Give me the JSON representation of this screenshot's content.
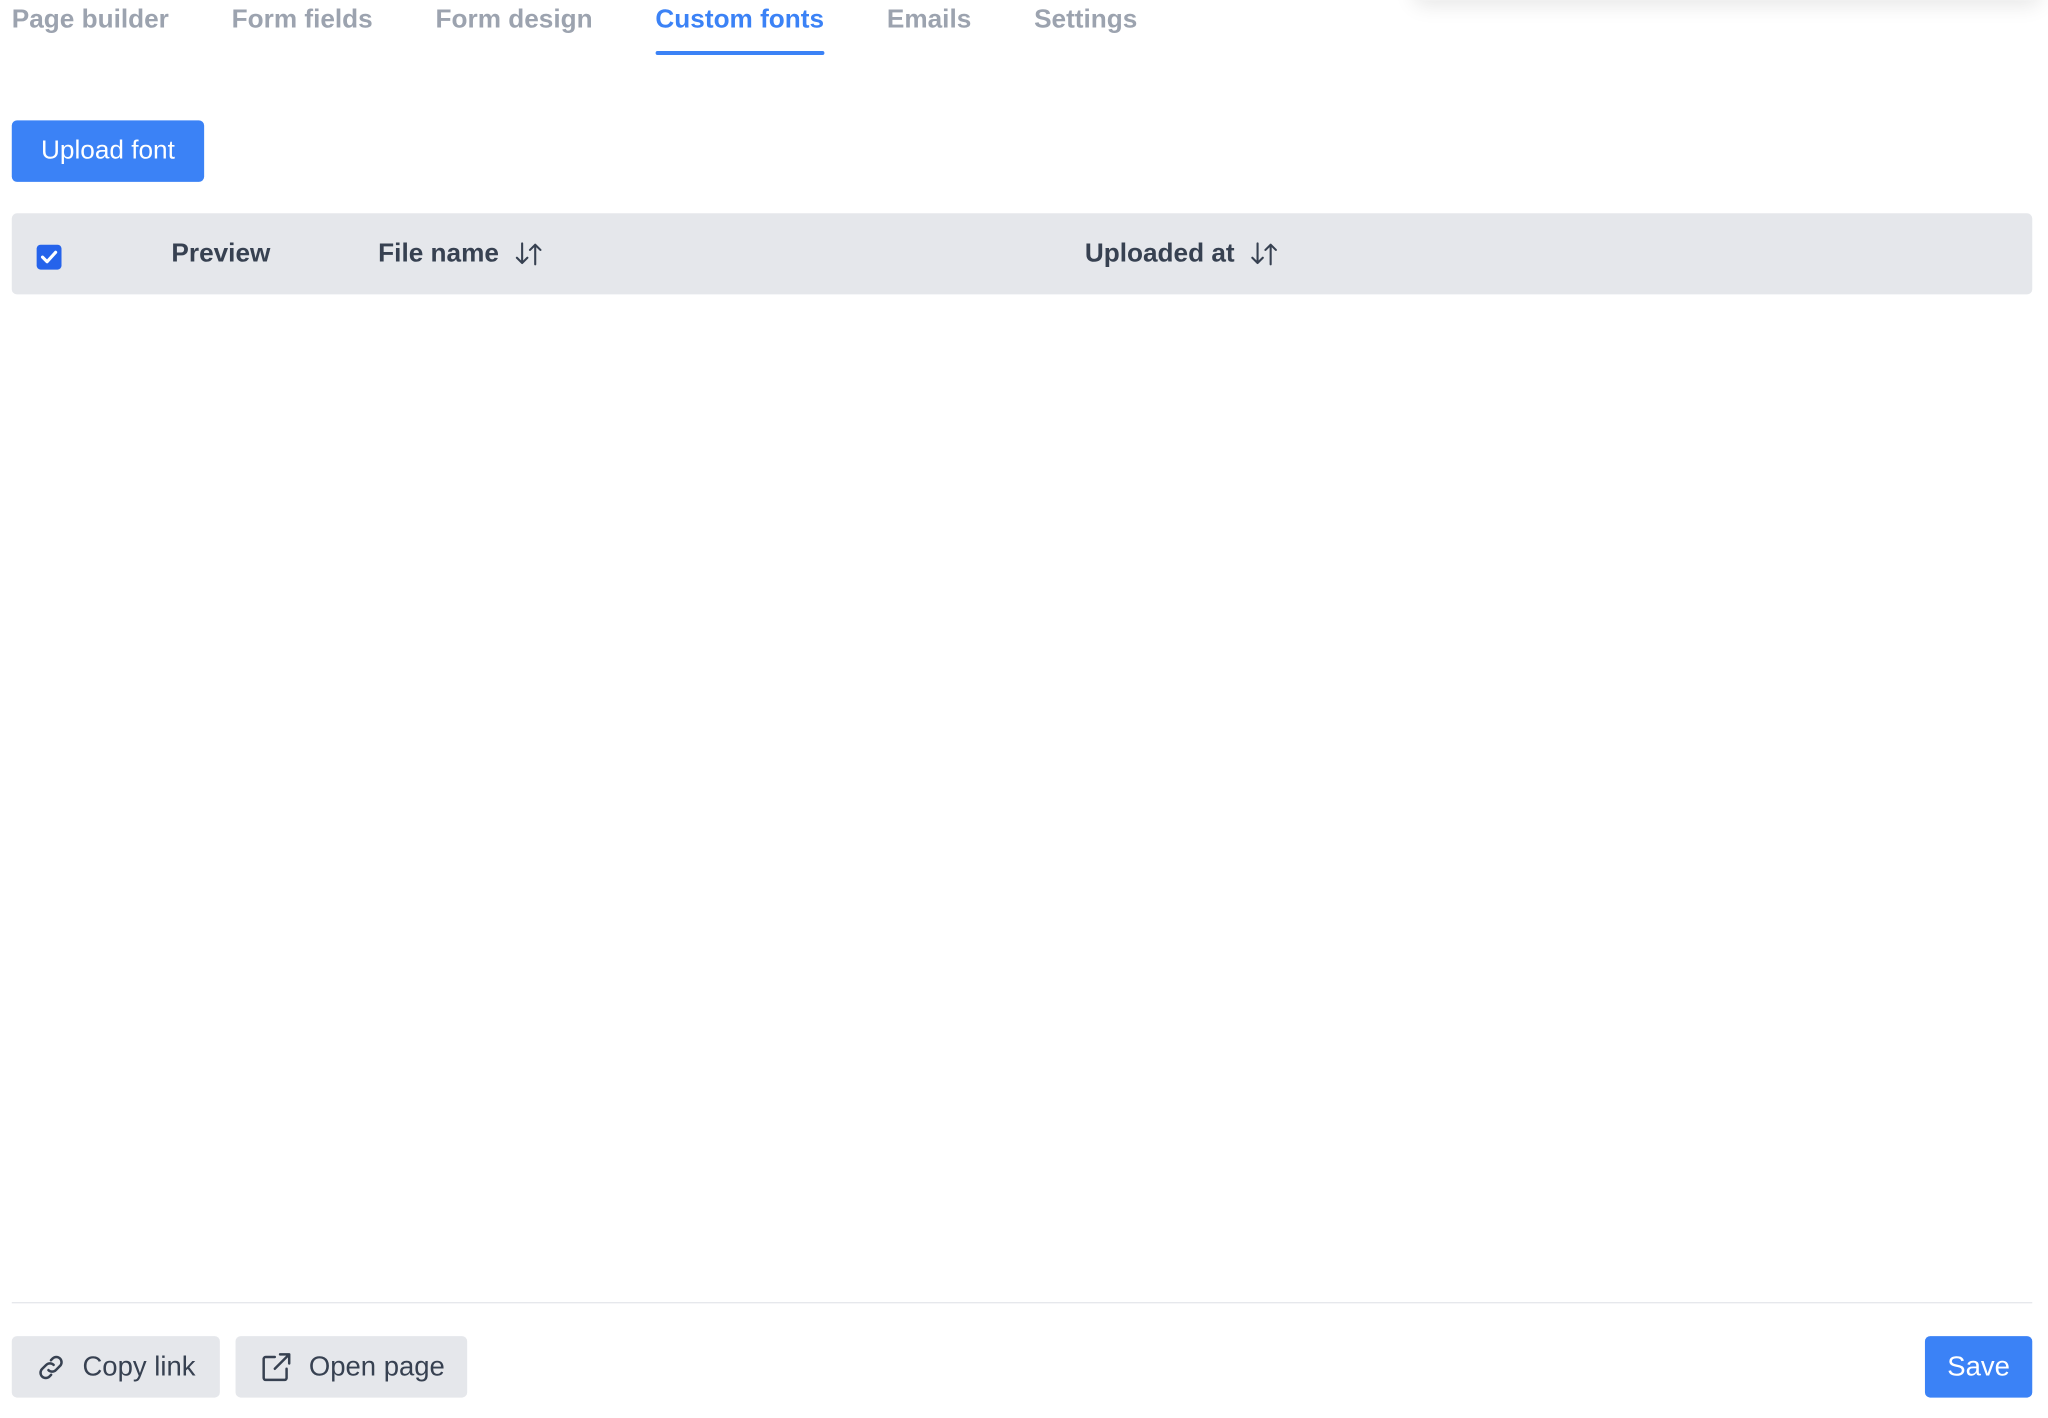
{
  "tabs": [
    {
      "label": "Page builder",
      "active": false
    },
    {
      "label": "Form fields",
      "active": false
    },
    {
      "label": "Form design",
      "active": false
    },
    {
      "label": "Custom fonts",
      "active": true
    },
    {
      "label": "Emails",
      "active": false
    },
    {
      "label": "Settings",
      "active": false
    }
  ],
  "toolbar": {
    "upload_label": "Upload font"
  },
  "table": {
    "select_all_checked": true,
    "columns": [
      {
        "label": "Preview",
        "sortable": false
      },
      {
        "label": "File name",
        "sortable": true
      },
      {
        "label": "Uploaded at",
        "sortable": true
      }
    ],
    "rows": []
  },
  "footer": {
    "copy_label": "Copy link",
    "open_label": "Open page",
    "save_label": "Save"
  },
  "colors": {
    "accent": "#3b82f6",
    "checkbox": "#2563eb",
    "tab_inactive": "#9ca3af",
    "header_bg": "#e5e7eb",
    "text": "#374151"
  },
  "icons": {
    "sort": "sort-arrows-icon",
    "copy": "link-icon",
    "open": "external-link-icon",
    "check": "checkmark-icon"
  }
}
